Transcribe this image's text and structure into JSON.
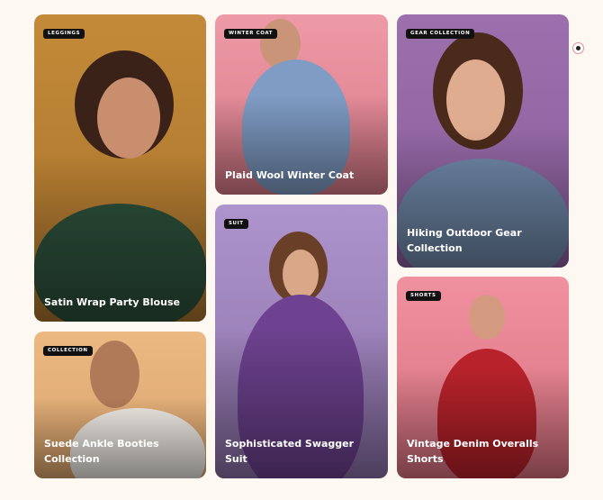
{
  "cards": [
    {
      "badge": "Leggings",
      "title": "Satin Wrap Party Blouse",
      "bg": "#c08a3a"
    },
    {
      "badge": "Collection",
      "title": "Suede Ankle Booties Collection",
      "bg": "#e9b57e"
    },
    {
      "badge": "Winter Coat",
      "title": "Plaid Wool Winter Coat",
      "bg": "#e48f9c"
    },
    {
      "badge": "Suit",
      "title": "Sophisticated Swagger Suit",
      "bg": "#a488c2"
    },
    {
      "badge": "Gear Collection",
      "title": "Hiking Outdoor Gear Collection",
      "bg": "#9a6eaa"
    },
    {
      "badge": "Shorts",
      "title": "Vintage Denim Overalls Shorts",
      "bg": "#ec8c98"
    }
  ]
}
